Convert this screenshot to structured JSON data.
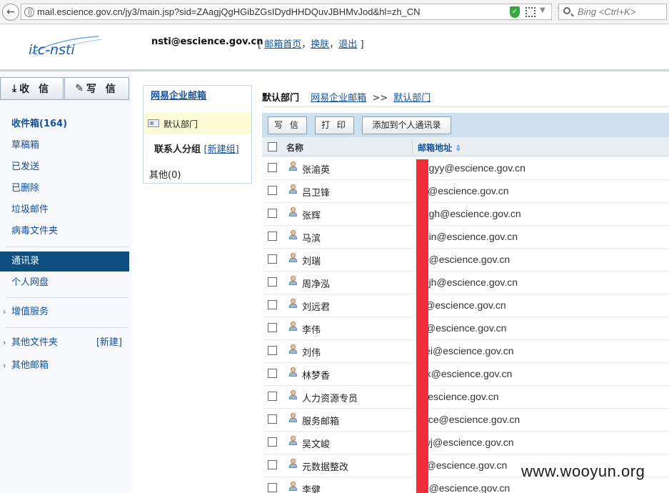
{
  "browser": {
    "url": "mail.escience.gov.cn/jy3/main.jsp?sid=ZAagjQgHGibZGsIDydHHDQuvJBHMvJod&hl=zh_CN",
    "search_placeholder": "Bing <Ctrl+K>"
  },
  "header": {
    "logo_text": "itc-nsti",
    "user_email": "nsti@escience.gov.cn",
    "link_home": "邮箱首页",
    "link_skin": "换肤",
    "link_logout": "退出",
    "bracket_open": "[",
    "bracket_close": "]",
    "comma": "，"
  },
  "nav": {
    "receive_label": "收 信",
    "write_label": "写 信",
    "inbox": "收件箱(164)",
    "drafts": "草稿箱",
    "sent": "已发送",
    "deleted": "已删除",
    "spam": "垃圾邮件",
    "virus": "病毒文件夹",
    "contacts": "通讯录",
    "netdisk": "个人网盘",
    "value_added": "增值服务",
    "other_folders": "其他文件夹",
    "new_folder": "[新建]",
    "other_mailbox": "其他邮箱"
  },
  "contacts_panel": {
    "title": "网易企业邮箱",
    "dept": "默认部门",
    "groups_label": "联系人分组",
    "new_group": "新建组",
    "other": "其他(0)"
  },
  "content": {
    "breadcrumb_current": "默认部门",
    "breadcrumb_root": "网易企业邮箱",
    "breadcrumb_sep": ">>",
    "breadcrumb_leaf": "默认部门",
    "toolbar": {
      "write": "写 信",
      "print": "打 印",
      "add_personal": "添加到个人通讯录"
    },
    "columns": {
      "name": "名称",
      "email": "邮箱地址"
    },
    "rows": [
      {
        "name": "张渝英",
        "email": "angyy@escience.gov.cn"
      },
      {
        "name": "吕卫锋",
        "email": "wf@escience.gov.cn"
      },
      {
        "name": "张辉",
        "email": "angh@escience.gov.cn"
      },
      {
        "name": "马滨",
        "email": "abin@escience.gov.cn"
      },
      {
        "name": "刘瑞",
        "email": "rui@escience.gov.cn"
      },
      {
        "name": "周净泓",
        "email": "oujh@escience.gov.cn"
      },
      {
        "name": "刘远君",
        "email": "yj@escience.gov.cn"
      },
      {
        "name": "李伟",
        "email": "ei@escience.gov.cn"
      },
      {
        "name": "刘伟",
        "email": "wei@escience.gov.cn"
      },
      {
        "name": "林梦香",
        "email": "mx@escience.gov.cn"
      },
      {
        "name": "人力资源专员",
        "email": "@escience.gov.cn"
      },
      {
        "name": "服务邮箱",
        "email": "rvice@escience.gov.cn"
      },
      {
        "name": "吴文峻",
        "email": "uwj@escience.gov.cn"
      },
      {
        "name": "元数据整改",
        "email": "ta@escience.gov.cn"
      },
      {
        "name": "李健",
        "email": "an@escience.gov.cn"
      }
    ]
  },
  "watermark": "www.wooyun.org",
  "colors": {
    "link": "#15509a",
    "active_nav": "#0e4f80",
    "toolbar_bg": "#cde0f0",
    "redaction": "#ef2d39"
  },
  "icons": [
    "back-icon",
    "globe-icon",
    "shield-icon",
    "qr-icon",
    "reload-icon",
    "search-icon",
    "download-icon",
    "edit-icon",
    "contact-card-icon",
    "person-icon",
    "sort-arrow-icon",
    "chevron-right-icon"
  ]
}
